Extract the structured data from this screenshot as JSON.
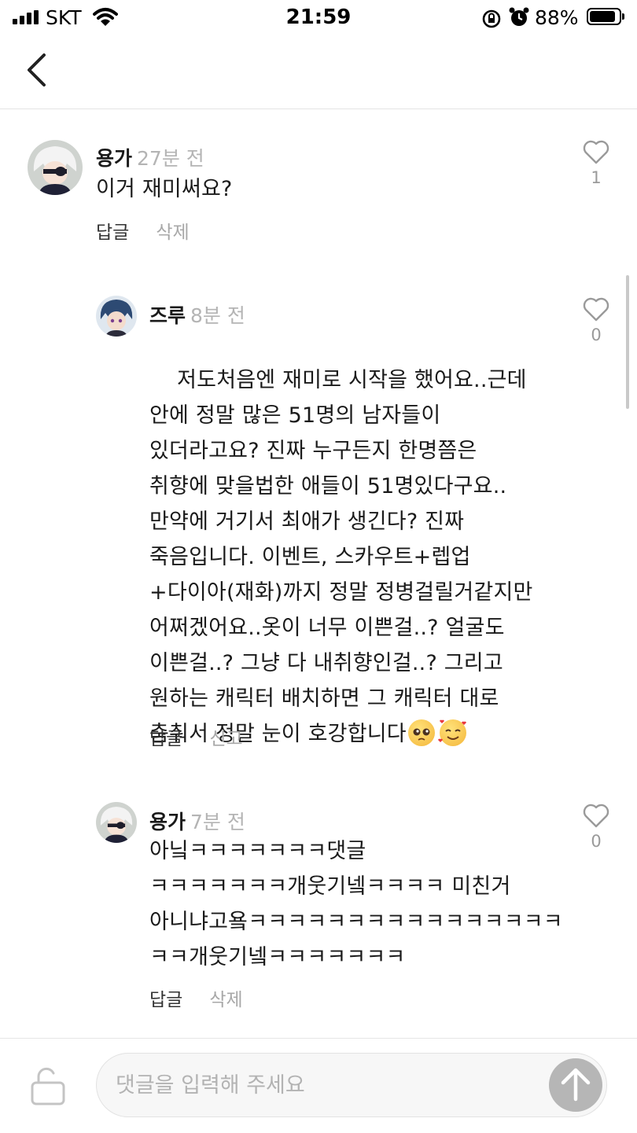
{
  "status_bar": {
    "carrier": "SKT",
    "time": "21:59",
    "battery": "88%",
    "battery_level": 0.88
  },
  "nav": {
    "back_icon": "chevron-left-icon"
  },
  "comments": [
    {
      "author": "용가",
      "time": "27분 전",
      "body": "이거 재미써요?",
      "likes": "1",
      "reply_label": "답글",
      "action_label": "삭제"
    },
    {
      "author": "즈루",
      "time": "8분 전",
      "body": "저도처음엔 재미로 시작을 했어요..근데\n안에 정말 많은 51명의 남자들이\n있더라고요? 진짜 누구든지 한명쯤은\n취향에 맞을법한 애들이 51명있다구요..\n만약에 거기서 최애가 생긴다? 진짜\n죽음입니다. 이벤트, 스카우트+렙업\n+다이아(재화)까지 정말 정병걸릴거같지만\n어쩌겠어요..옷이 너무 이쁜걸..? 얼굴도\n이쁜걸..? 그냥 다 내취향인걸..? 그리고\n원하는 캐릭터 배치하면 그 캐릭터 대로\n춤춰서 정말 눈이 호강합니다",
      "emoji": [
        "pleading-face-emoji",
        "smiling-face-with-hearts-emoji"
      ],
      "likes": "0",
      "reply_label": "답글",
      "action_label": "신고"
    },
    {
      "author": "용가",
      "time": "7분 전",
      "body": "아닠ㅋㅋㅋㅋㅋㅋㅋ댓글\nㅋㅋㅋㅋㅋㅋㅋ개웃기넼ㅋㅋㅋㅋ 미친거\n아니냐고욬ㅋㅋㅋㅋㅋㅋㅋㅋㅋㅋㅋㅋㅋㅋㅋㅋ\nㅋㅋ개웃기넼ㅋㅋㅋㅋㅋㅋㅋ",
      "likes": "0",
      "reply_label": "답글",
      "action_label": "삭제"
    }
  ],
  "input": {
    "placeholder": "댓글을 입력해 주세요",
    "value": "",
    "lock_icon": "unlock-icon",
    "send_icon": "arrow-up-icon"
  },
  "colors": {
    "accent_gray": "#b6b6b6",
    "timestamp": "#b4b4b4",
    "secondary_action": "#a8a8a8"
  }
}
